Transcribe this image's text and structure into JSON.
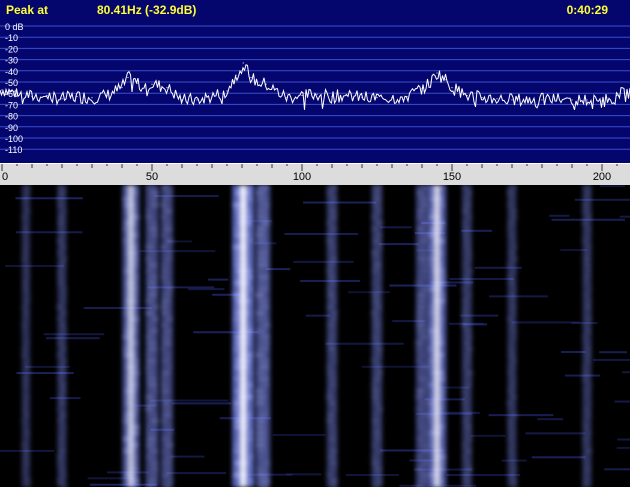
{
  "status": {
    "peak_label": "Peak at",
    "peak_value": "80.41Hz (-32.9dB)",
    "clock": "0:40:29"
  },
  "colors": {
    "spectrum_bg": "#05056e",
    "grid": "#3a4fd0",
    "trace": "#ffffff",
    "status_text": "#ffff33",
    "axis_bar": "#dcdcdc",
    "waterfall_glow": "#7e8cff"
  },
  "chart_data": [
    {
      "type": "line",
      "ylabel": "dB",
      "yticks": [
        "0 dB",
        "-10",
        "-20",
        "-30",
        "-40",
        "-50",
        "-60",
        "-70",
        "-80",
        "-90",
        "-100",
        "-110"
      ],
      "ylim": [
        -110,
        0
      ],
      "xlim": [
        0,
        210
      ],
      "grid": true,
      "series": [
        {
          "x": [
            0,
            5,
            10,
            15,
            20,
            25,
            30,
            35,
            40,
            42,
            45,
            50,
            55,
            60,
            65,
            70,
            75,
            78,
            80.41,
            83,
            85,
            88,
            90,
            95,
            100,
            105,
            110,
            115,
            120,
            125,
            130,
            135,
            140,
            143,
            145,
            148,
            150,
            155,
            160,
            165,
            170,
            175,
            180,
            185,
            190,
            195,
            200,
            205,
            210
          ],
          "values": [
            -57,
            -60,
            -63,
            -62,
            -65,
            -63,
            -64,
            -62,
            -55,
            -46,
            -51,
            -52,
            -55,
            -66,
            -66,
            -63,
            -58,
            -44,
            -33,
            -46,
            -50,
            -52,
            -56,
            -64,
            -62,
            -61,
            -63,
            -62,
            -64,
            -64,
            -64,
            -63,
            -56,
            -50,
            -42,
            -48,
            -55,
            -62,
            -64,
            -65,
            -66,
            -66,
            -66,
            -65,
            -66,
            -66,
            -67,
            -62,
            -58
          ]
        }
      ]
    },
    {
      "type": "heatmap",
      "xticks": [
        "0",
        "50",
        "100",
        "150",
        "200"
      ],
      "xlim": [
        0,
        210
      ],
      "bands": [
        {
          "x": 43,
          "intensity": 0.7
        },
        {
          "x": 50,
          "intensity": 0.45
        },
        {
          "x": 55,
          "intensity": 0.4
        },
        {
          "x": 80.4,
          "intensity": 1.0
        },
        {
          "x": 87,
          "intensity": 0.55
        },
        {
          "x": 145,
          "intensity": 0.8
        },
        {
          "x": 140,
          "intensity": 0.4
        },
        {
          "x": 110,
          "intensity": 0.3
        },
        {
          "x": 125,
          "intensity": 0.3
        },
        {
          "x": 155,
          "intensity": 0.25
        },
        {
          "x": 170,
          "intensity": 0.2
        },
        {
          "x": 195,
          "intensity": 0.2
        },
        {
          "x": 20,
          "intensity": 0.2
        },
        {
          "x": 8,
          "intensity": 0.15
        }
      ]
    }
  ]
}
